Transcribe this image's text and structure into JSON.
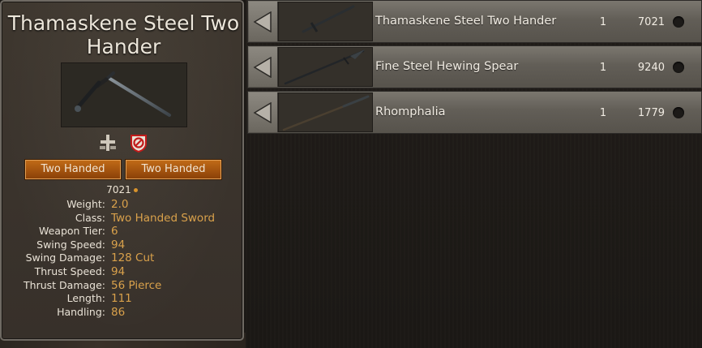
{
  "tooltip": {
    "title": "Thamaskene Steel Two Hander",
    "tags": [
      "Two Handed",
      "Two Handed"
    ],
    "price": "7021",
    "stats": [
      {
        "label": "Weight:",
        "value": "2.0"
      },
      {
        "label": "Class:",
        "value": "Two Handed Sword"
      },
      {
        "label": "Weapon Tier:",
        "value": "6"
      },
      {
        "label": "Swing Speed:",
        "value": "94"
      },
      {
        "label": "Swing Damage:",
        "value": "128 Cut"
      },
      {
        "label": "Thrust Speed:",
        "value": "94"
      },
      {
        "label": "Thrust Damage:",
        "value": "56 Pierce"
      },
      {
        "label": "Length:",
        "value": "111"
      },
      {
        "label": "Handling:",
        "value": "86"
      }
    ],
    "icons": [
      "crossbar-craft-icon",
      "no-restriction-shield-icon"
    ]
  },
  "items": [
    {
      "name": "Thamaskene Steel Two Hander",
      "qty": "1",
      "price": "7021",
      "icon": "sword-icon"
    },
    {
      "name": "Fine Steel Hewing Spear",
      "qty": "1",
      "price": "9240",
      "icon": "spear-icon"
    },
    {
      "name": "Rhomphalia",
      "qty": "1",
      "price": "1779",
      "icon": "polearm-icon"
    }
  ],
  "colors": {
    "tag_orange": "#b05f12",
    "stat_value": "#d9a14b",
    "row_gray": "#6a665f"
  }
}
